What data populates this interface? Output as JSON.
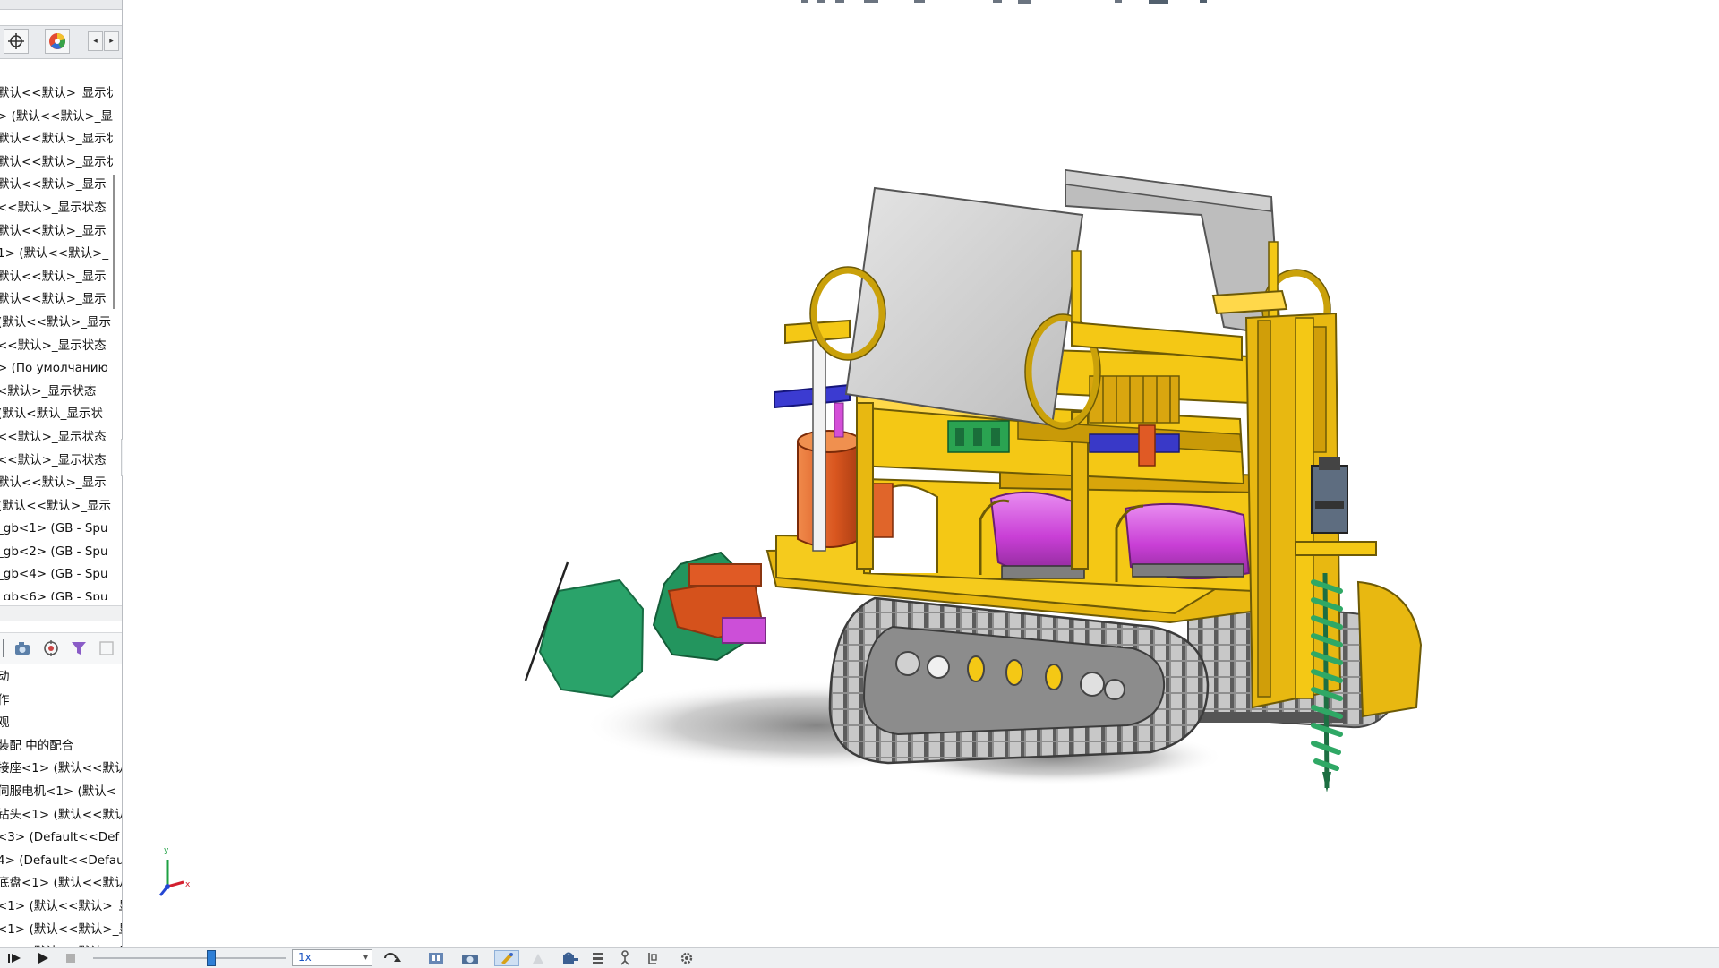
{
  "feature_tree_upper": [
    "默认<<默认>_显示状",
    "> (默认<<默认>_显",
    "默认<<默认>_显示状",
    "默认<<默认>_显示状",
    "默认<<默认>_显示",
    "<<默认>_显示状态",
    "默认<<默认>_显示",
    "1> (默认<<默认>_",
    "默认<<默认>_显示",
    "默认<<默认>_显示",
    "(默认<<默认>_显示",
    "<<默认>_显示状态",
    "> (По умолчанию",
    "<默认>_显示状态",
    "(默认<默认_显示状",
    "<<默认>_显示状态",
    "<<默认>_显示状态",
    "默认<<默认>_显示",
    "(默认<<默认>_显示",
    "_gb<1> (GB - Spu",
    "_gb<2> (GB - Spu",
    "_gb<4> (GB - Spu",
    "_gb<6> (GB - Spu"
  ],
  "feature_tree_lower": [
    "动",
    "作",
    "观",
    "装配 中的配合",
    "接座<1> (默认<<默认",
    "伺服电机<1> (默认<",
    "钻头<1> (默认<<默认",
    "<3> (Default<<Def",
    "4> (Default<<Defaul",
    "底盘<1> (默认<<默认",
    "<1> (默认<<默认>_显",
    "<1> (默认<<默认>_显",
    "<1> (默认<<默认>_显"
  ],
  "tab_icons": [
    "crosshair-icon",
    "appearance-icon"
  ],
  "lower_toolbar_icons": [
    "camera-icon",
    "target-icon",
    "filter-icon",
    "placeholder-icon"
  ],
  "bottom_bar": {
    "speed_value": "1x",
    "icons": [
      "play-forward-icon",
      "play-icon",
      "stop-icon",
      "loop-icon",
      "calculate-icon",
      "camera-icon",
      "auto-key-icon",
      "add-key-icon",
      "stack-icon",
      "motor-icon",
      "spring-icon",
      "settings-icon"
    ],
    "timeline_position": 0.62
  },
  "colors": {
    "frame_yellow": "#f0c419",
    "tank_magenta": "#c93fd6",
    "cylinder_orange": "#e2622a",
    "track_gray": "#9b9b9b",
    "plate_gray": "#d6d6d6",
    "auger_green": "#2fa865",
    "wheel_green": "#24955d",
    "accent_blue": "#3b3bd1"
  }
}
